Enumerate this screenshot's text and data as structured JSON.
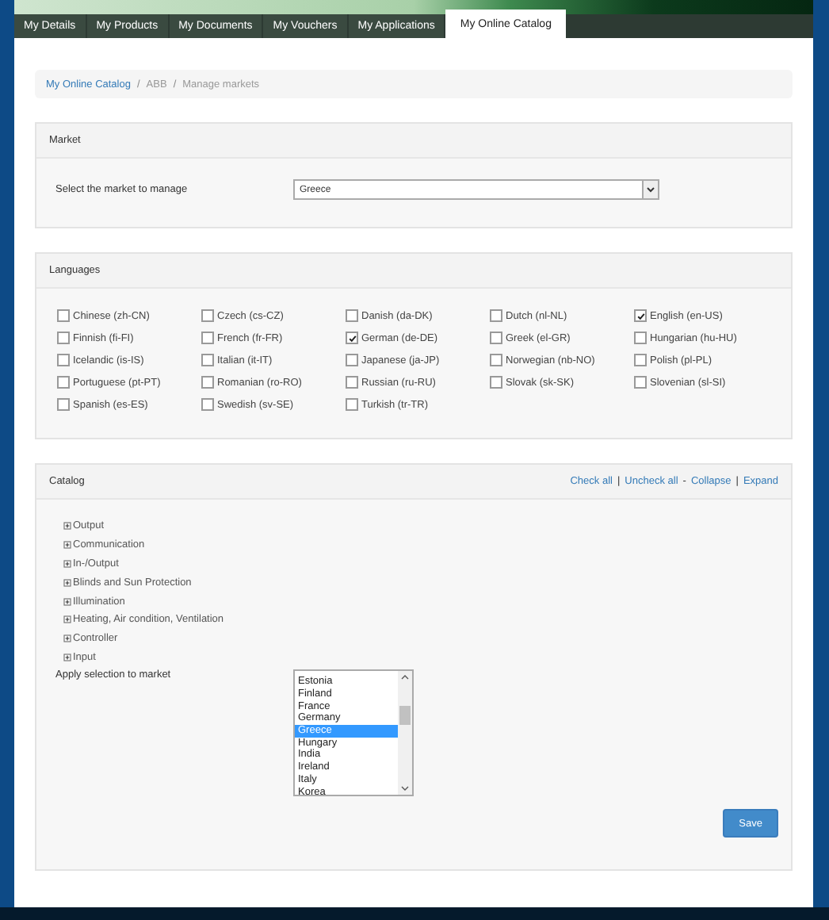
{
  "tabs": [
    {
      "label": "My Details",
      "selected": false
    },
    {
      "label": "My Products",
      "selected": false
    },
    {
      "label": "My Documents",
      "selected": false
    },
    {
      "label": "My Vouchers",
      "selected": false
    },
    {
      "label": "My Applications",
      "selected": false
    },
    {
      "label": "My Online Catalog",
      "selected": true
    }
  ],
  "breadcrumb": [
    {
      "label": "My Online Catalog",
      "kind": "link"
    },
    {
      "label": "/",
      "kind": "sep"
    },
    {
      "label": "ABB",
      "kind": "text"
    },
    {
      "label": "/",
      "kind": "sep"
    },
    {
      "label": "Manage markets",
      "kind": "text"
    }
  ],
  "market": {
    "title": "Market",
    "label": "Select the market to manage",
    "value": "Greece"
  },
  "languages": {
    "title": "Languages",
    "items": [
      {
        "label": "Chinese (zh-CN)",
        "checked": false
      },
      {
        "label": "Czech (cs-CZ)",
        "checked": false
      },
      {
        "label": "Danish (da-DK)",
        "checked": false
      },
      {
        "label": "Dutch (nl-NL)",
        "checked": false
      },
      {
        "label": "English (en-US)",
        "checked": true
      },
      {
        "label": "Finnish (fi-FI)",
        "checked": false
      },
      {
        "label": "French (fr-FR)",
        "checked": false
      },
      {
        "label": "German (de-DE)",
        "checked": true
      },
      {
        "label": "Greek (el-GR)",
        "checked": false
      },
      {
        "label": "Hungarian (hu-HU)",
        "checked": false
      },
      {
        "label": "Icelandic (is-IS)",
        "checked": false
      },
      {
        "label": "Italian (it-IT)",
        "checked": false
      },
      {
        "label": "Japanese (ja-JP)",
        "checked": false
      },
      {
        "label": "Norwegian (nb-NO)",
        "checked": false
      },
      {
        "label": "Polish (pl-PL)",
        "checked": false
      },
      {
        "label": "Portuguese (pt-PT)",
        "checked": false
      },
      {
        "label": "Romanian (ro-RO)",
        "checked": false
      },
      {
        "label": "Russian (ru-RU)",
        "checked": false
      },
      {
        "label": "Slovak (sk-SK)",
        "checked": false
      },
      {
        "label": "Slovenian (sl-SI)",
        "checked": false
      },
      {
        "label": "Spanish (es-ES)",
        "checked": false
      },
      {
        "label": "Swedish (sv-SE)",
        "checked": false
      },
      {
        "label": "Turkish (tr-TR)",
        "checked": false
      }
    ]
  },
  "catalog": {
    "title": "Catalog",
    "actions": [
      {
        "label": "Check all",
        "kind": "link"
      },
      {
        "label": "|",
        "kind": "sep"
      },
      {
        "label": "Uncheck all",
        "kind": "link"
      },
      {
        "label": "-",
        "kind": "sep"
      },
      {
        "label": "Collapse",
        "kind": "link"
      },
      {
        "label": "|",
        "kind": "sep"
      },
      {
        "label": "Expand",
        "kind": "link"
      }
    ],
    "tree": [
      {
        "label": "Output",
        "expanded": false
      },
      {
        "label": "Communication",
        "expanded": false
      },
      {
        "label": "In-/Output",
        "expanded": false
      },
      {
        "label": "Blinds and Sun Protection",
        "expanded": false
      },
      {
        "label": "Illumination",
        "expanded": false
      },
      {
        "label": "Heating, Air condition, Ventilation",
        "expanded": false
      },
      {
        "label": "Controller",
        "expanded": false
      },
      {
        "label": "Input",
        "expanded": false
      }
    ],
    "apply_label": "Apply selection to market",
    "markets": [
      {
        "label": "Estonia",
        "selected": false
      },
      {
        "label": "Finland",
        "selected": false
      },
      {
        "label": "France",
        "selected": false
      },
      {
        "label": "Germany",
        "selected": false
      },
      {
        "label": "Greece",
        "selected": true
      },
      {
        "label": "Hungary",
        "selected": false
      },
      {
        "label": "India",
        "selected": false
      },
      {
        "label": "Ireland",
        "selected": false
      },
      {
        "label": "Italy",
        "selected": false
      },
      {
        "label": "Korea",
        "selected": false
      }
    ],
    "save": "Save"
  }
}
